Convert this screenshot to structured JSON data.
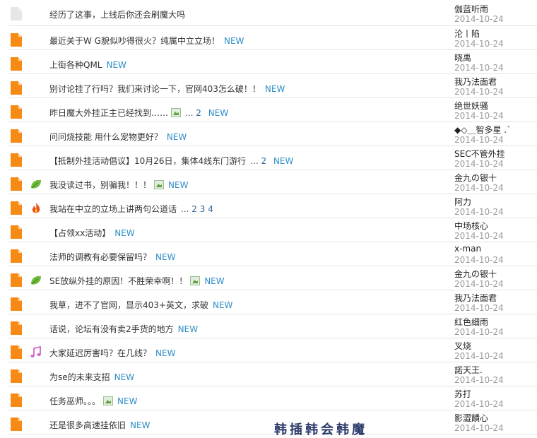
{
  "threads": [
    {
      "title": "经历了这事，上线后你还会刷魔大吗",
      "author": "伽蓝听雨",
      "date": "2014-10-24",
      "new": "",
      "icon": "grey",
      "tag": "",
      "img": false,
      "pages": [],
      "pages_prefix": ""
    },
    {
      "title": "最近关于W G貌似吵得很火？纯属中立立场！",
      "author": "沦丨陷",
      "date": "2014-10-24",
      "new": "NEW",
      "icon": "orange",
      "tag": "",
      "img": false,
      "pages": [],
      "pages_prefix": ""
    },
    {
      "title": "上街各种QML",
      "author": "晓禹",
      "date": "2014-10-24",
      "new": "NEW",
      "icon": "orange",
      "tag": "",
      "img": false,
      "pages": [],
      "pages_prefix": ""
    },
    {
      "title": "别讨论挂了行吗？我们来讨论一下，官网403怎么破！！",
      "author": "我乃法面君",
      "date": "2014-10-24",
      "new": "NEW",
      "icon": "orange",
      "tag": "",
      "img": false,
      "pages": [],
      "pages_prefix": ""
    },
    {
      "title": "昨日魔大外挂正主已经找到……",
      "author": "绝世妖骚",
      "date": "2014-10-24",
      "new": "NEW",
      "icon": "orange",
      "tag": "",
      "img": true,
      "pages": [
        "2"
      ],
      "pages_prefix": "..."
    },
    {
      "title": "问问烧技能 用什么宠物更好？",
      "author": "◆◇＿智多星 .`",
      "date": "2014-10-24",
      "new": "NEW",
      "icon": "orange",
      "tag": "",
      "img": false,
      "pages": [],
      "pages_prefix": ""
    },
    {
      "title": "【抵制外挂活动倡议】10月26日，集体4线东门游行",
      "author": "SEC不管外挂",
      "date": "2014-10-24",
      "new": "NEW",
      "icon": "orange",
      "tag": "",
      "img": false,
      "pages": [
        "2"
      ],
      "pages_prefix": "..."
    },
    {
      "title": "我没读过书，别骗我！！！",
      "author": "金九の银十",
      "date": "2014-10-24",
      "new": "NEW",
      "icon": "orange",
      "tag": "leaf",
      "img": true,
      "pages": [],
      "pages_prefix": ""
    },
    {
      "title": "我站在中立的立场上讲两句公道话",
      "author": "阿力",
      "date": "2014-10-24",
      "new": "",
      "icon": "orange",
      "tag": "fire",
      "img": false,
      "pages": [
        "2",
        "3",
        "4"
      ],
      "pages_prefix": "..."
    },
    {
      "title": "【占领xx活动】",
      "author": "中场核心",
      "date": "2014-10-24",
      "new": "NEW",
      "icon": "orange",
      "tag": "",
      "img": false,
      "pages": [],
      "pages_prefix": ""
    },
    {
      "title": "法师的调教有必要保留吗？",
      "author": "x-man",
      "date": "2014-10-24",
      "new": "NEW",
      "icon": "orange",
      "tag": "",
      "img": false,
      "pages": [],
      "pages_prefix": ""
    },
    {
      "title": "SE放纵外挂的原因！不胜荣幸啊！！",
      "author": "金九の银十",
      "date": "2014-10-24",
      "new": "NEW",
      "icon": "orange",
      "tag": "leaf",
      "img": true,
      "pages": [],
      "pages_prefix": ""
    },
    {
      "title": "我草，进不了官网，显示403+英文，求破",
      "author": "我乃法面君",
      "date": "2014-10-24",
      "new": "NEW",
      "icon": "orange",
      "tag": "",
      "img": false,
      "pages": [],
      "pages_prefix": ""
    },
    {
      "title": "话说，论坛有没有卖2手货的地方",
      "author": "红色细雨",
      "date": "2014-10-24",
      "new": "NEW",
      "icon": "orange",
      "tag": "",
      "img": false,
      "pages": [],
      "pages_prefix": ""
    },
    {
      "title": "大家延迟厉害吗？在几线？",
      "author": "叉烧",
      "date": "2014-10-24",
      "new": "NEW",
      "icon": "orange",
      "tag": "music",
      "img": false,
      "pages": [],
      "pages_prefix": ""
    },
    {
      "title": "为se的未来支招",
      "author": "諾天王.",
      "date": "2014-10-24",
      "new": "NEW",
      "icon": "orange",
      "tag": "",
      "img": false,
      "pages": [],
      "pages_prefix": ""
    },
    {
      "title": "任务巫师。。。",
      "author": "苏打",
      "date": "2014-10-24",
      "new": "NEW",
      "icon": "orange",
      "tag": "",
      "img": true,
      "pages": [],
      "pages_prefix": ""
    },
    {
      "title": "还是很多高速挂依旧",
      "author": "影澀饋心",
      "date": "2014-10-24",
      "new": "NEW",
      "icon": "orange",
      "tag": "",
      "img": false,
      "pages": [],
      "pages_prefix": ""
    }
  ],
  "watermark": "韩插韩会韩魔"
}
